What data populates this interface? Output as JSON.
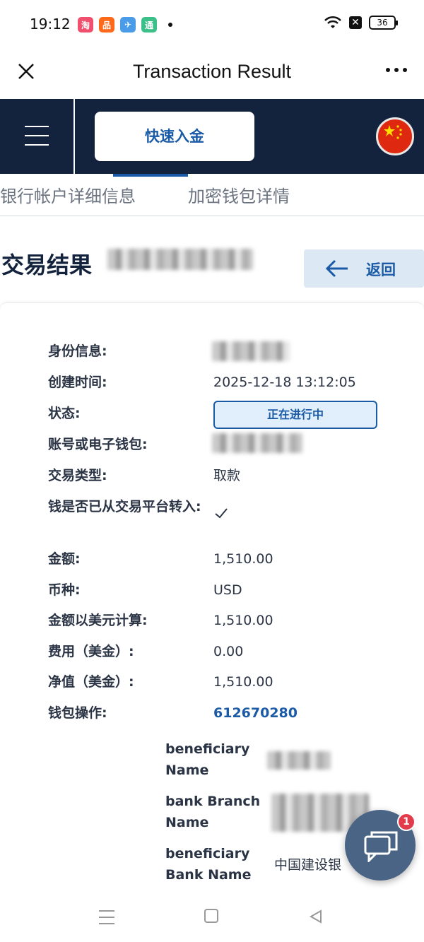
{
  "status_bar": {
    "time": "19:12",
    "battery": "36",
    "apps": [
      {
        "icon": "taobao-app-icon",
        "color": "#f0506e",
        "glyph": "淘"
      },
      {
        "icon": "app2-icon",
        "color": "#ff6a1a",
        "glyph": "品"
      },
      {
        "icon": "app3-icon",
        "color": "#4a9be8",
        "glyph": "✈"
      },
      {
        "icon": "app4-icon",
        "color": "#3cc08a",
        "glyph": "通"
      }
    ]
  },
  "title_bar": {
    "title": "Transaction Result"
  },
  "header": {
    "deposit_label": "快速入金",
    "accent_color": "#14233d"
  },
  "tabs": [
    {
      "label": "银行帐户详细信息"
    },
    {
      "label": "加密钱包详情"
    }
  ],
  "page": {
    "title": "交易结果",
    "back_label": "返回"
  },
  "details": {
    "identity_label": "身份信息:",
    "created_label": "创建时间:",
    "created_value": "2025-12-18 13:12:05",
    "status_label": "状态:",
    "status_value": "正在进行中",
    "account_label": "账号或电子钱包:",
    "type_label": "交易类型:",
    "type_value": "取款",
    "transferred_label": "钱是否已从交易平台转入:",
    "amount_label": "金额:",
    "amount_value": "1,510.00",
    "currency_label": "币种:",
    "currency_value": "USD",
    "usd_amount_label": "金额以美元计算:",
    "usd_amount_value": "1,510.00",
    "fee_label": "费用（美金）:",
    "fee_value": "0.00",
    "net_label": "净值（美金）:",
    "net_value": "1,510.00",
    "wallet_op_label": "钱包操作:",
    "wallet_op_value": "612670280"
  },
  "bank": {
    "beneficiary_name_label": "beneficiary Name",
    "branch_name_label": "bank Branch Name",
    "bank_name_label": "beneficiary Bank Name",
    "bank_name_value": "中国建设银"
  },
  "chat": {
    "badge": "1"
  }
}
